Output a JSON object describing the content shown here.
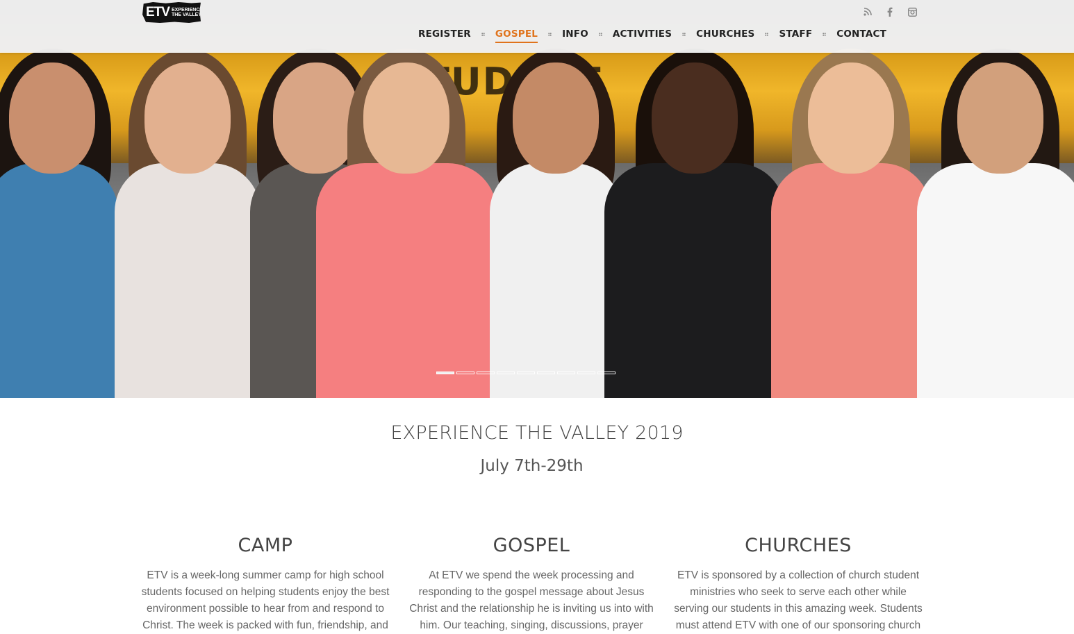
{
  "brand": {
    "logo_text": "ETV",
    "logo_subtext": "EXPERIENCE THE VALLEY"
  },
  "social": [
    {
      "icon": "rss-icon"
    },
    {
      "icon": "facebook-icon"
    },
    {
      "icon": "instagram-icon"
    }
  ],
  "nav": {
    "items": [
      "REGISTER",
      "GOSPEL",
      "INFO",
      "ACTIVITIES",
      "CHURCHES",
      "STAFF",
      "CONTACT"
    ],
    "active": "GOSPEL"
  },
  "hero": {
    "bus_text": "TUDENT",
    "slide_count": 9,
    "active_slide": 1
  },
  "intro": {
    "title": "EXPERIENCE THE VALLEY 2019",
    "dates": "July 7th-29th"
  },
  "columns": [
    {
      "title": "CAMP",
      "text": "ETV is a week-long summer camp for high school students focused on helping students enjoy the best environment possible to hear from and respond to Christ. The week is packed with fun, friendship, and"
    },
    {
      "title": "GOSPEL",
      "text": "At ETV we spend the week processing and responding to the gospel message about Jesus Christ and the relationship he is inviting us into with him. Our teaching, singing, discussions, prayer"
    },
    {
      "title": "CHURCHES",
      "text": "ETV is sponsored by a collection of church student ministries who seek to serve each other while serving our students in this amazing week. Students must attend ETV with one of our sponsoring church"
    }
  ],
  "colors": {
    "accent": "#e0731c",
    "nav_text": "#222222",
    "heading_text": "#444444",
    "body_text": "#666666"
  }
}
